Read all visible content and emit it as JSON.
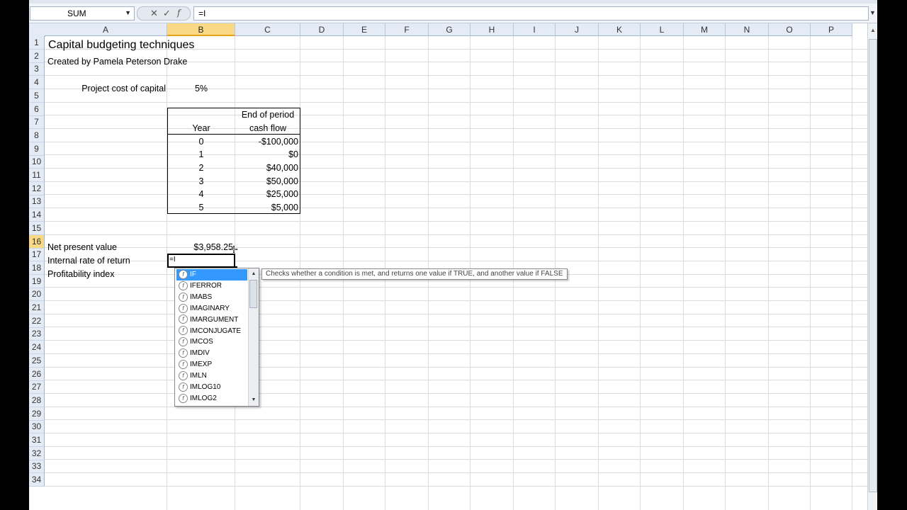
{
  "formula_bar": {
    "name_box": "SUM",
    "formula": "=I"
  },
  "columns": [
    "A",
    "B",
    "C",
    "D",
    "E",
    "F",
    "G",
    "H",
    "I",
    "J",
    "K",
    "L",
    "M",
    "N",
    "O",
    "P"
  ],
  "rows": [
    "1",
    "2",
    "3",
    "4",
    "5",
    "6",
    "7",
    "8",
    "9",
    "10",
    "11",
    "12",
    "13",
    "14",
    "15",
    "16",
    "17",
    "18",
    "19",
    "20",
    "21",
    "22",
    "23",
    "24",
    "25",
    "26",
    "27",
    "28",
    "29",
    "30",
    "31",
    "32",
    "33",
    "34"
  ],
  "active": {
    "column": "B",
    "row": "16"
  },
  "sheet": {
    "title": "Capital budgeting techniques",
    "author": "Created by Pamela Peterson Drake",
    "cost_of_capital_label": "Project cost of capital",
    "cost_of_capital_value": "5%",
    "table": {
      "year_header": "Year",
      "cash_flow_header_1": "End of period",
      "cash_flow_header_2": "cash flow",
      "years": [
        "0",
        "1",
        "2",
        "3",
        "4",
        "5"
      ],
      "cash_flows": [
        "-$100,000",
        "$0",
        "$40,000",
        "$50,000",
        "$25,000",
        "$5,000"
      ]
    },
    "npv_label": "Net present value",
    "npv_value": "$3,958.25",
    "irr_label": "Internal rate of return",
    "irr_input": "=I",
    "pi_label": "Profitability index"
  },
  "autocomplete": {
    "items": [
      "IF",
      "IFERROR",
      "IMABS",
      "IMAGINARY",
      "IMARGUMENT",
      "IMCONJUGATE",
      "IMCOS",
      "IMDIV",
      "IMEXP",
      "IMLN",
      "IMLOG10",
      "IMLOG2"
    ],
    "selected_index": 0,
    "tooltip": "Checks whether a condition is met, and returns one value if TRUE, and another value if FALSE"
  }
}
